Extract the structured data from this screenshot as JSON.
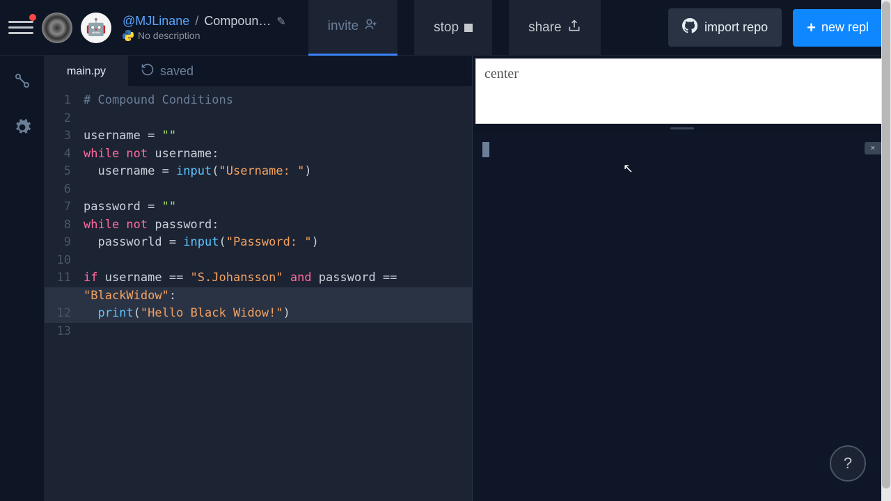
{
  "header": {
    "owner": "@MJLinane",
    "separator": "/",
    "repl_name": "Compoun…",
    "description": "No description",
    "language": "python",
    "buttons": {
      "invite": "invite",
      "stop": "stop",
      "share": "share",
      "import_repo": "import repo",
      "new_repl": "new repl"
    }
  },
  "sidebar": {
    "version_icon": "version-control",
    "settings_icon": "settings"
  },
  "editor": {
    "tab_name": "main.py",
    "save_status": "saved",
    "lines": [
      {
        "n": 1
      },
      {
        "n": 2
      },
      {
        "n": 3
      },
      {
        "n": 4
      },
      {
        "n": 5
      },
      {
        "n": 6
      },
      {
        "n": 7
      },
      {
        "n": 8
      },
      {
        "n": 9
      },
      {
        "n": 10
      },
      {
        "n": 11
      },
      {
        "n": 12
      },
      {
        "n": 13
      }
    ],
    "code_tokens": {
      "l1_comment": "# Compound Conditions",
      "l3_var": "username = ",
      "l3_str": "\"\"",
      "l4_while": "while",
      "l4_not": " not",
      "l4_rest": " username:",
      "l5_body": "  username = ",
      "l5_func": "input",
      "l5_open": "(",
      "l5_str": "\"Username: \"",
      "l5_close": ")",
      "l7_var": "password = ",
      "l7_str": "\"\"",
      "l8_while": "while",
      "l8_not": " not",
      "l8_rest": " password:",
      "l9_body": "  passworld = ",
      "l9_func": "input",
      "l9_open": "(",
      "l9_str": "\"Password: \"",
      "l9_close": ")",
      "l11_if": "if",
      "l11_a": " username == ",
      "l11_str1": "\"S.Johansson\"",
      "l11_and": " and",
      "l11_b": " password == ",
      "l11_cont": "\"BlackWidow\"",
      "l11_colon": ":",
      "l12_indent": "  ",
      "l12_print": "print",
      "l12_open": "(",
      "l12_str": "\"Hello Black Widow!\"",
      "l12_close": ")"
    }
  },
  "output": {
    "text": "center"
  },
  "console": {
    "close_label": "×"
  },
  "help": {
    "label": "?"
  }
}
